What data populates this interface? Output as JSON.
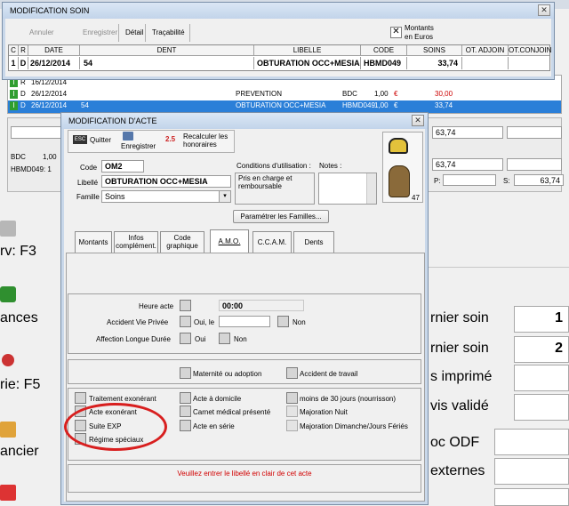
{
  "background": {
    "left_labels": [
      "rv: F3",
      "ances",
      "rie: F5",
      "ancier"
    ],
    "right_labels": [
      "rnier soin",
      "rnier soin",
      "s imprimé",
      "vis validé",
      "oc ODF",
      "externes"
    ],
    "right_values": [
      "1",
      "2"
    ],
    "list_rows": [
      {
        "flag": "I",
        "type": "R",
        "date": "16/12/2014",
        "dent": "",
        "libelle": "",
        "code": "",
        "qty": "",
        "cur": "",
        "amount": ""
      },
      {
        "flag": "I",
        "type": "D",
        "date": "26/12/2014",
        "dent": "",
        "libelle": "PREVENTION",
        "code": "BDC",
        "qty": "1,00",
        "cur": "€",
        "amount": "30,00"
      },
      {
        "flag": "I",
        "type": "D",
        "date": "26/12/2014",
        "dent": "54",
        "libelle": "OBTURATION OCC+MESIA",
        "code": "HBMD049",
        "qty": "1,00",
        "cur": "€",
        "amount": "33,74"
      }
    ],
    "info_bdc": "BDC",
    "info_bdc_val": "1,00",
    "info_hbmd": "HBMD049: 1",
    "totals": [
      "63,74",
      "63,74"
    ],
    "p_label": "P:",
    "s_label": "S:",
    "s_value": "63,74"
  },
  "soin_window": {
    "title": "MODIFICATION SOIN",
    "toolbar": {
      "annuler": "Annuler",
      "enregistrer": "Enregistrer",
      "detail": "Détail",
      "tracabilite": "Traçabilité"
    },
    "montants_label": "Montants\nen Euros",
    "columns": [
      "C",
      "R",
      "DATE",
      "DENT",
      "LIBELLE",
      "CODE",
      "SOINS",
      "OT. ADJOIN",
      "OT.CONJOIN"
    ],
    "row": {
      "c": "1",
      "r": "D",
      "date": "26/12/2014",
      "dent": "54",
      "libelle": "OBTURATION OCC+MESIA",
      "code": "HBMD049",
      "soins": "33,74"
    }
  },
  "acte_window": {
    "title": "MODIFICATION D'ACTE",
    "toolbar": {
      "quitter": "Quitter",
      "enregistrer": "Enregistrer",
      "recalculer": "Recalculer les honoraires"
    },
    "code_label": "Code",
    "code_value": "OM2",
    "libelle_label": "Libellé",
    "libelle_value": "OBTURATION OCC+MESIA",
    "famille_label": "Famille",
    "famille_value": "Soins",
    "conditions_label": "Conditions d'utilisation :",
    "conditions_value": "Pris en charge et remboursable",
    "notes_label": "Notes :",
    "tooth_number": "47",
    "parametrer_label": "Paramétrer les Familles...",
    "tabs": [
      "Montants",
      "Infos complément.",
      "Code graphique",
      "A.M.O.",
      "C.C.A.M.",
      "Dents"
    ],
    "active_tab": "A.M.O.",
    "heure_label": "Heure acte",
    "heure_value": "00:00",
    "accident_label": "Accident Vie Privée",
    "oui_le_label": "Oui, le",
    "non_label": "Non",
    "ald_label": "Affection Longue Durée",
    "oui_label": "Oui",
    "maternite_label": "Maternité ou adoption",
    "accident_travail_label": "Accident de travail",
    "checks_col1": [
      "Traitement exonérant",
      "Acte exonérant",
      "Suite EXP",
      "Régime spéciaux"
    ],
    "checks_col2": [
      "Acte à domicile",
      "Carnet médical présenté",
      "Acte en série"
    ],
    "checks_col3": [
      "moins de 30 jours (nourrisson)",
      "Majoration Nuit",
      "Majoration Dimanche/Jours Fériés"
    ],
    "status_message": "Veuillez entrer le libellé en clair de cet acte"
  },
  "colors": {
    "selection": "#2b7fd8",
    "status_text": "#d10000",
    "highlight_circle": "#d81f1f",
    "montant_red": "#cc0000"
  }
}
